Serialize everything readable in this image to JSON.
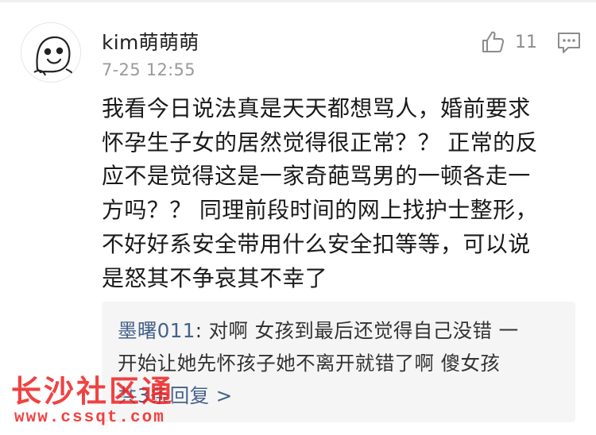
{
  "comment": {
    "username": "kim萌萌萌",
    "timestamp": "7-25 12:55",
    "like_count": "11",
    "body_lines": [
      "我看今日说法真是天天都想骂人，婚前要求",
      "怀孕生子女的居然觉得很正常？？ 正常的反",
      "应不是觉得这是一家奇葩骂男的一顿各走一",
      "方吗？？ 同理前段时间的网上找护士整形，",
      "不好好系安全带用什么安全扣等等，可以说",
      "是怒其不争哀其不幸了"
    ]
  },
  "reply": {
    "author": "墨曙011",
    "separator": ": ",
    "lines": [
      "对啊 女孩到最后还觉得自己没错 一",
      "开始让她先怀孩子她不离开就错了啊 傻女孩"
    ],
    "more_label": "共3条回复 >"
  },
  "watermark": {
    "title": "长沙社区通",
    "url": "www.cssqt.com"
  },
  "icons": {
    "avatar": "cartoon-face-avatar",
    "like": "thumbs-up-icon",
    "comment": "comment-bubble-icon"
  },
  "colors": {
    "reply_author": "#45628a",
    "reply_background": "#f5f5f5",
    "watermark": "#ee2222",
    "muted_text": "#9a9a9a"
  }
}
